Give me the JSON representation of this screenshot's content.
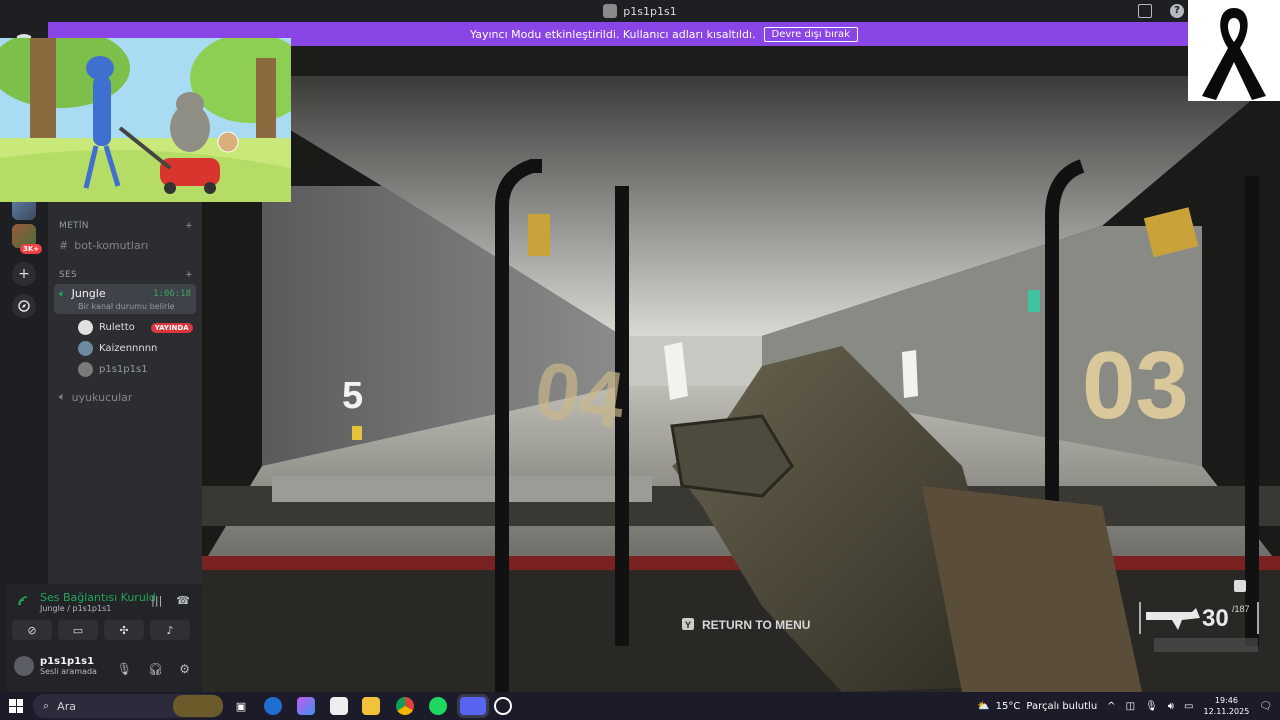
{
  "window": {
    "title": "p1s1p1s1"
  },
  "banner": {
    "message": "Yayıncı Modu etkinleştirildi. Kullanıcı adları kısaltıldı.",
    "button": "Devre dışı bırak"
  },
  "guilds": {
    "badge": "3K+"
  },
  "channels": {
    "text_category": "METİN",
    "text_channel": "bot-komutları",
    "voice_category": "SES",
    "voice_channel": "Jungle",
    "voice_timer": "1:06:18",
    "voice_status": "Bir kanal durumu belirle",
    "members": [
      {
        "name": "Ruletto",
        "badge": "YAYINDA"
      },
      {
        "name": "Kaizennnnn",
        "badge": ""
      },
      {
        "name": "p1s1p1s1",
        "badge": ""
      }
    ],
    "other_voice_channel": "uyukucular"
  },
  "voice_panel": {
    "status": "Ses Bağlantısı Kuruld",
    "location": "Jungle / p1s1p1s1",
    "user_name": "p1s1p1s1",
    "user_status": "Sesli aramada"
  },
  "stream": {
    "hud_menu": "RETURN TO MENU",
    "hud_key": "Y",
    "ammo": "30",
    "reserve": "/187",
    "lane_left": "5",
    "lane_mid": "04",
    "lane_right": "03"
  },
  "taskbar": {
    "search_placeholder": "Ara",
    "weather_temp": "15°C",
    "weather_text": "Parçalı bulutlu",
    "time": "19:46",
    "date": "12.11.2025"
  },
  "colors": {
    "banner": "#8a45e6",
    "live_badge": "#da373c",
    "connected": "#23a55a"
  }
}
